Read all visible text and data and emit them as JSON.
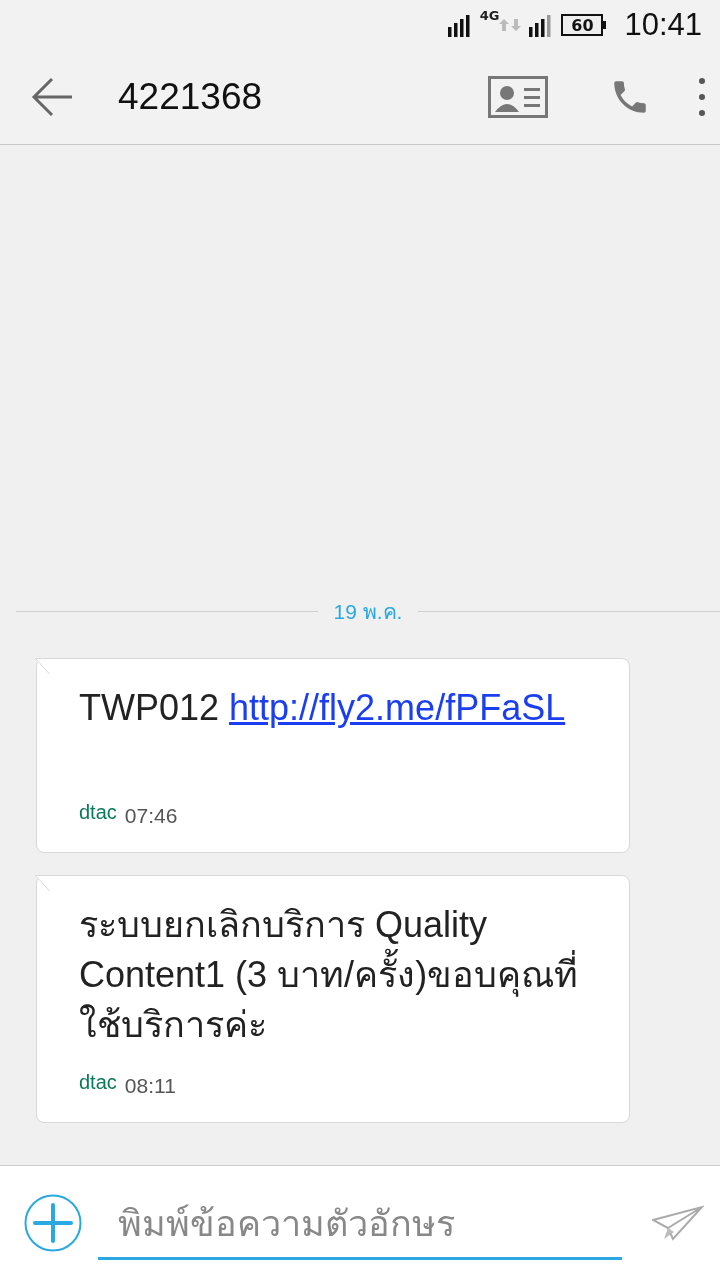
{
  "status_bar": {
    "network": "4G",
    "battery": "60",
    "time": "10:41"
  },
  "header": {
    "title": "4221368"
  },
  "date_divider": "19 พ.ค.",
  "messages": [
    {
      "parts": [
        {
          "kind": "text",
          "text": "TWP012 "
        },
        {
          "kind": "link",
          "text": "http://fly2.me/fPFaSL"
        }
      ],
      "sender": "dtac",
      "time": "07:46"
    },
    {
      "parts": [
        {
          "kind": "text",
          "text": "ระบบยกเลิกบริการ Quality Content1 (3 บาท/ครั้ง)ขอบคุณที่ใช้บริการค่ะ"
        }
      ],
      "sender": "dtac",
      "time": "08:11"
    }
  ],
  "compose": {
    "placeholder": "พิมพ์ข้อความตัวอักษร"
  }
}
